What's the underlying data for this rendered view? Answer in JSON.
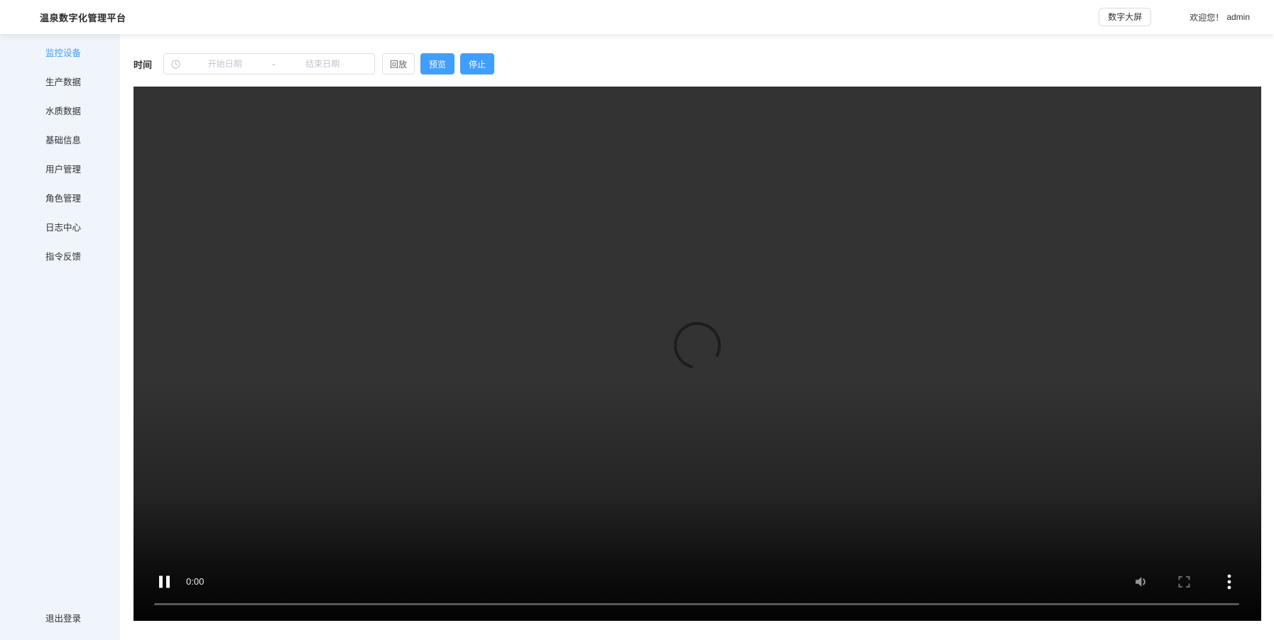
{
  "header": {
    "title": "温泉数字化管理平台",
    "screen_button": "数字大屏",
    "welcome": "欢迎您！",
    "username": "admin"
  },
  "sidebar": {
    "items": [
      {
        "label": "监控设备",
        "active": true
      },
      {
        "label": "生产数据",
        "active": false
      },
      {
        "label": "水质数据",
        "active": false
      },
      {
        "label": "基础信息",
        "active": false
      },
      {
        "label": "用户管理",
        "active": false
      },
      {
        "label": "角色管理",
        "active": false
      },
      {
        "label": "日志中心",
        "active": false
      },
      {
        "label": "指令反馈",
        "active": false
      }
    ],
    "logout": "退出登录"
  },
  "toolbar": {
    "time_label": "时间",
    "start_placeholder": "开始日期",
    "separator": "-",
    "end_placeholder": "结束日期",
    "playback_button": "回放",
    "preview_button": "预览",
    "stop_button": "停止"
  },
  "player": {
    "state": "loading",
    "current_time": "0:00",
    "icons": {
      "pause": "pause-icon",
      "volume": "volume-icon",
      "fullscreen": "fullscreen-icon",
      "overflow": "three-dot-menu-icon",
      "clock": "clock-icon",
      "spinner": "loading-spinner"
    }
  },
  "colors": {
    "primary": "#409EFF",
    "sidebar_bg": "#eff5fb",
    "video_bg": "#333333",
    "border": "#dcdfe6",
    "placeholder": "#c0c4cc",
    "text": "#303133"
  }
}
